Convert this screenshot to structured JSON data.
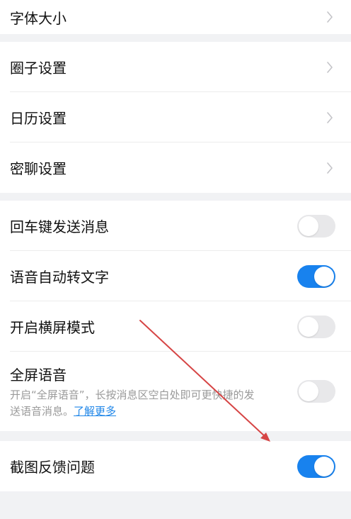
{
  "colors": {
    "background": "#f1f2f4",
    "toggle_on": "#1882ee",
    "toggle_off": "#e8e8ea",
    "link": "#1f86e8",
    "annotation_arrow": "#d64545"
  },
  "groups": [
    {
      "rows": [
        {
          "label": "字体大小",
          "control": "chevron",
          "icon": "chevron-right-icon"
        }
      ]
    },
    {
      "rows": [
        {
          "label": "圈子设置",
          "control": "chevron",
          "icon": "chevron-right-icon"
        },
        {
          "label": "日历设置",
          "control": "chevron",
          "icon": "chevron-right-icon"
        },
        {
          "label": "密聊设置",
          "control": "chevron",
          "icon": "chevron-right-icon"
        }
      ]
    },
    {
      "rows": [
        {
          "label": "回车键发送消息",
          "control": "toggle",
          "state": "off"
        },
        {
          "label": "语音自动转文字",
          "control": "toggle",
          "state": "on"
        },
        {
          "label": "开启横屏模式",
          "control": "toggle",
          "state": "off"
        },
        {
          "label": "全屏语音",
          "control": "toggle",
          "state": "off",
          "description": "开启“全屏语音”，长按消息区空白处即可更快捷的发送语音消息。",
          "link": "了解更多"
        }
      ]
    },
    {
      "rows": [
        {
          "label": "截图反馈问题",
          "control": "toggle",
          "state": "on"
        }
      ]
    }
  ]
}
